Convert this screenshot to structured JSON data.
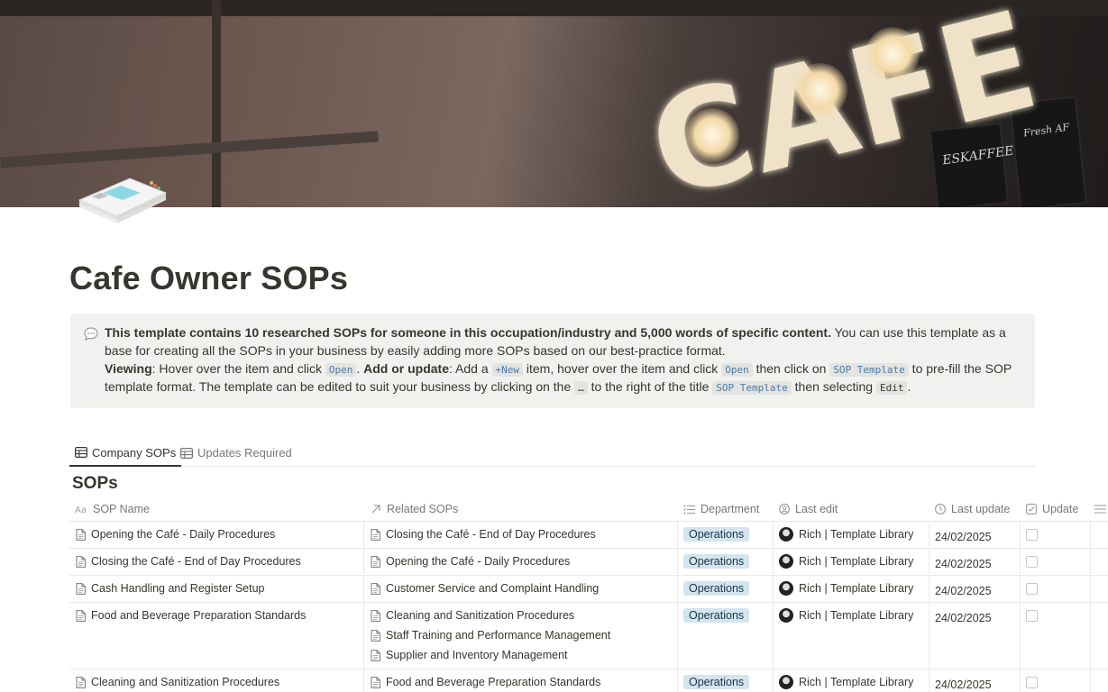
{
  "cover": {
    "sign_text": "CAFE",
    "chalkboard_text": "ESKAFFEE",
    "chalkboard_text_2": "Fresh AF"
  },
  "page_icon": "sop-documents-icon",
  "page": {
    "title": "Cafe Owner SOPs"
  },
  "callout": {
    "icon": "speech-bubble-icon",
    "line1_bold": "This template contains 10 researched SOPs for someone in this occupation/industry and 5,000 words of specific content.",
    "line1_rest": " You can use this template as a base for creating all the SOPs in your business by easily adding more SOPs based on our best-practice format.",
    "viewing_label": "Viewing",
    "viewing_text": ": Hover over the item and click ",
    "open_code": "Open",
    "add_label": "Add or update",
    "add_text": ": Add a ",
    "new_code": "+New",
    "add_text2": " item, hover over the item and click ",
    "open_code2": "Open",
    "add_text3": " then click on ",
    "sop_template_code": "SOP Template",
    "add_text4": " to pre-fill the SOP template format. The template can be edited to suit your business by clicking on the ",
    "ellipsis_code": "…",
    "add_text5": " to the right of the title ",
    "sop_template_code2": "SOP Template",
    "add_text6": " then selecting ",
    "edit_code": "Edit",
    "add_text7": "."
  },
  "tabs": [
    {
      "label": "Company SOPs",
      "icon": "table-icon",
      "active": true
    },
    {
      "label": "Updates Required",
      "icon": "table-icon",
      "active": false
    }
  ],
  "database": {
    "title": "SOPs",
    "columns": [
      {
        "label": "SOP Name",
        "icon": "text-aa-icon"
      },
      {
        "label": "Related SOPs",
        "icon": "relation-arrow-icon"
      },
      {
        "label": "Department",
        "icon": "list-icon"
      },
      {
        "label": "Last edit",
        "icon": "person-icon"
      },
      {
        "label": "Last update",
        "icon": "clock-icon"
      },
      {
        "label": "Update",
        "icon": "checkbox-icon"
      }
    ],
    "rows": [
      {
        "name": "Opening the Café - Daily Procedures",
        "related": [
          "Closing the Café - End of Day Procedures"
        ],
        "department": "Operations",
        "last_edit": "Rich | Template Library",
        "last_update": "24/02/2025",
        "update": false
      },
      {
        "name": "Closing the Café - End of Day Procedures",
        "related": [
          "Opening the Café - Daily Procedures"
        ],
        "department": "Operations",
        "last_edit": "Rich | Template Library",
        "last_update": "24/02/2025",
        "update": false
      },
      {
        "name": "Cash Handling and Register Setup",
        "related": [
          "Customer Service and Complaint Handling"
        ],
        "department": "Operations",
        "last_edit": "Rich | Template Library",
        "last_update": "24/02/2025",
        "update": false
      },
      {
        "name": "Food and Beverage Preparation Standards",
        "related": [
          "Cleaning and Sanitization Procedures",
          "Staff Training and Performance Management",
          "Supplier and Inventory Management"
        ],
        "department": "Operations",
        "last_edit": "Rich | Template Library",
        "last_update": "24/02/2025",
        "update": false
      },
      {
        "name": "Cleaning and Sanitization Procedures",
        "related": [
          "Food and Beverage Preparation Standards"
        ],
        "department": "Operations",
        "last_edit": "Rich | Template Library",
        "last_update": "24/02/2025",
        "update": false
      }
    ]
  },
  "colors": {
    "tag_bg": "#d3e5ef",
    "tag_text": "#183347",
    "callout_bg": "#f1f1ef",
    "code_text": "#4a7aa6"
  }
}
